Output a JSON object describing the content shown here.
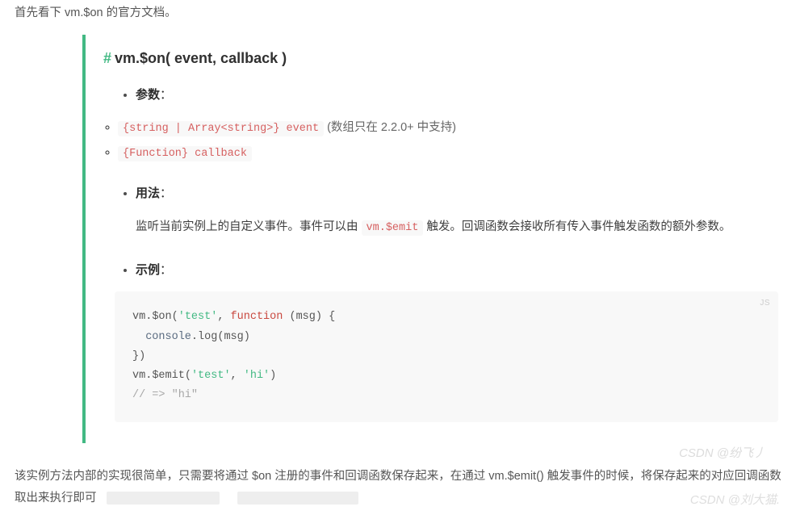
{
  "intro": "首先看下 vm.$on 的官方文档。",
  "heading": {
    "hash": "#",
    "title": "vm.$on( event, callback )"
  },
  "labels": {
    "params": "参数",
    "usage": "用法",
    "example": "示例",
    "colon": "："
  },
  "params": [
    {
      "code": "{string | Array<string>} event",
      "note": "(数组只在 2.2.0+ 中支持)"
    },
    {
      "code": "{Function} callback",
      "note": ""
    }
  ],
  "usage": {
    "before": "监听当前实例上的自定义事件。事件可以由 ",
    "code": "vm.$emit",
    "after": " 触发。回调函数会接收所有传入事件触发函数的额外参数。"
  },
  "codeblock": {
    "lang": "JS",
    "lines": [
      [
        {
          "t": "vm.",
          "c": "tok-plain"
        },
        {
          "t": "$on",
          "c": "tok-plain"
        },
        {
          "t": "(",
          "c": "tok-punc"
        },
        {
          "t": "'test'",
          "c": "tok-str"
        },
        {
          "t": ", ",
          "c": "tok-punc"
        },
        {
          "t": "function",
          "c": "tok-kw"
        },
        {
          "t": " (",
          "c": "tok-punc"
        },
        {
          "t": "msg",
          "c": "tok-plain"
        },
        {
          "t": ") {",
          "c": "tok-punc"
        }
      ],
      [
        {
          "t": "  ",
          "c": "tok-plain"
        },
        {
          "t": "console",
          "c": "tok-id"
        },
        {
          "t": ".",
          "c": "tok-punc"
        },
        {
          "t": "log",
          "c": "tok-plain"
        },
        {
          "t": "(",
          "c": "tok-punc"
        },
        {
          "t": "msg",
          "c": "tok-plain"
        },
        {
          "t": ")",
          "c": "tok-punc"
        }
      ],
      [
        {
          "t": "})",
          "c": "tok-punc"
        }
      ],
      [
        {
          "t": "vm.",
          "c": "tok-plain"
        },
        {
          "t": "$emit",
          "c": "tok-plain"
        },
        {
          "t": "(",
          "c": "tok-punc"
        },
        {
          "t": "'test'",
          "c": "tok-str"
        },
        {
          "t": ", ",
          "c": "tok-punc"
        },
        {
          "t": "'hi'",
          "c": "tok-str"
        },
        {
          "t": ")",
          "c": "tok-punc"
        }
      ],
      [
        {
          "t": "// => \"hi\"",
          "c": "tok-comment"
        }
      ]
    ]
  },
  "watermarks": {
    "top": "CSDN @纷飞丿",
    "bottom": "CSDN @刘大猫."
  },
  "footer": "该实例方法内部的实现很简单，只需要将通过 $on 注册的事件和回调函数保存起来，在通过 vm.$emit() 触发事件的时候，将保存起来的对应回调函数取出来执行即可"
}
